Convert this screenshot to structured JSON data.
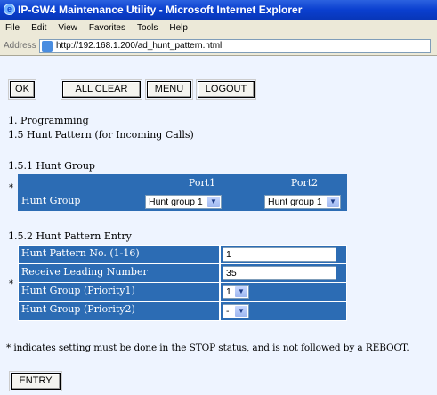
{
  "window": {
    "title": "IP-GW4 Maintenance Utility - Microsoft Internet Explorer"
  },
  "menu": [
    "File",
    "Edit",
    "View",
    "Favorites",
    "Tools",
    "Help"
  ],
  "address": {
    "label": "Address",
    "url": "http://192.168.1.200/ad_hunt_pattern.html"
  },
  "toolbar": {
    "ok": "OK",
    "all_clear": "ALL CLEAR",
    "menu": "MENU",
    "logout": "LOGOUT"
  },
  "section": {
    "heading": "1. Programming",
    "subheading": "1.5 Hunt Pattern (for Incoming Calls)"
  },
  "hunt_group": {
    "heading": "1.5.1 Hunt Group",
    "star": "*",
    "columns": [
      "Port1",
      "Port2"
    ],
    "row_label": "Hunt Group",
    "port1_value": "Hunt group 1",
    "port2_value": "Hunt group 1"
  },
  "hunt_pattern": {
    "heading": "1.5.2 Hunt Pattern Entry",
    "star": "*",
    "rows": [
      {
        "label": "Hunt Pattern No. (1-16)",
        "value": "1"
      },
      {
        "label": "Receive Leading Number",
        "value": "35"
      },
      {
        "label": "Hunt Group (Priority1)",
        "value": "1"
      },
      {
        "label": "Hunt Group (Priority2)",
        "value": "-"
      }
    ]
  },
  "note": "* indicates setting must be done in the STOP status, and is not followed by a REBOOT.",
  "entry_button": "ENTRY",
  "colors": {
    "accent": "#2c6cb4",
    "background": "#eef4ff",
    "titlebar": "#0a3fcf"
  }
}
